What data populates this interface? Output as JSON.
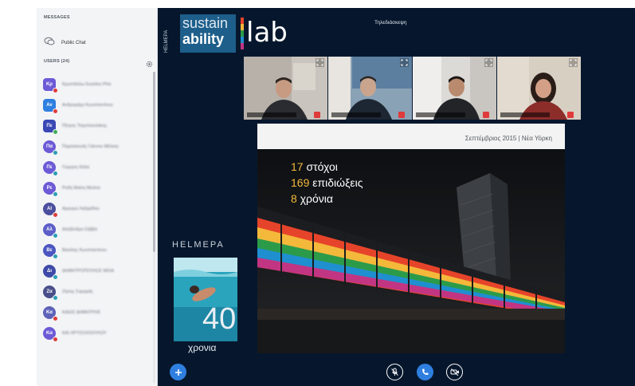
{
  "sidebar": {
    "messages_label": "MESSAGES",
    "public_chat_label": "Public Chat",
    "users_label": "USERS (24)",
    "users": [
      {
        "initials": "Κρ",
        "name": "Κρυστάλλω Ευαλίου Ρίτα",
        "color": "#6c5ad6",
        "shape": "square",
        "status": "red"
      },
      {
        "initials": "Αν",
        "name": "Ανδρομάχη Κωνσταντίνου",
        "color": "#2f7fe0",
        "shape": "square",
        "status": "red"
      },
      {
        "initials": "Πε",
        "name": "Πέτρος Τσιμπλουλάκης",
        "color": "#3a48b5",
        "shape": "square",
        "status": "green"
      },
      {
        "initials": "Πα",
        "name": "Παρασκευάς Γιάννου Μέλκας",
        "color": "#6c5ad6",
        "shape": "round",
        "status": "teal"
      },
      {
        "initials": "Πε",
        "name": "Γιώργος Κάλα",
        "color": "#6c5ad6",
        "shape": "round",
        "status": "teal"
      },
      {
        "initials": "Ρε",
        "name": "Ροδή Μαίνη Μελίνα",
        "color": "#6c5ad6",
        "shape": "round",
        "status": "teal"
      },
      {
        "initials": "ΑΙ",
        "name": "Αργυρώ Λαζαρίδου",
        "color": "#4c4f9e",
        "shape": "round",
        "status": "red"
      },
      {
        "initials": "Αλ",
        "name": "Αλεξάνδρα Σάββα",
        "color": "#5c5fc8",
        "shape": "round",
        "status": "teal"
      },
      {
        "initials": "Βε",
        "name": "Βασίλης Κωνσταντίνου",
        "color": "#4c56c0",
        "shape": "round",
        "status": "teal"
      },
      {
        "initials": "Δι",
        "name": "ΔΗΜΗΤΡΟΠΟΥΛΟΣ ΜΙΧΑ",
        "color": "#3e4aa8",
        "shape": "round",
        "status": "teal"
      },
      {
        "initials": "Ζα",
        "name": "Ζήσης Σαμαράς",
        "color": "#4a4f8a",
        "shape": "round",
        "status": "teal"
      },
      {
        "initials": "Κα",
        "name": "ΚΑΙΩΣ ΔΗΜΗΤΡΗΣ",
        "color": "#5e63b8",
        "shape": "round",
        "status": "red"
      },
      {
        "initials": "Κα",
        "name": "ΚΑΙ ΧΡΥΣΟΧΟΟΥΛΟΥ",
        "color": "#6c5ad6",
        "shape": "round",
        "status": "red"
      }
    ]
  },
  "header": {
    "org_vertical": "HELMEPA",
    "logo_sustain": "sustain",
    "logo_ability": "ability",
    "logo_lab": "lab",
    "meeting_title": "Τηλεδιάσκεψη"
  },
  "slide": {
    "caption": "Σεπτέμβριος 2015 | Νέα Υόρκη",
    "goals_num": "17",
    "goals_text": "στόχοι",
    "targets_num": "169",
    "targets_text": "επιδιώξεις",
    "years_num": "8",
    "years_text": "χρόνια"
  },
  "ad": {
    "brand": "HELMEPA",
    "number": "40",
    "word": "χρονια"
  },
  "colors": {
    "accent": "#2f7fe0",
    "stage": "#06172d",
    "mic_off": "#df3b3b"
  },
  "icons": {
    "public_chat": "chat-bubble-icon",
    "users_settings": "gear-icon",
    "add": "plus-icon",
    "mute": "microphone-off-icon",
    "audio": "phone-icon",
    "video": "camera-off-icon",
    "expand": "fullscreen-icon"
  }
}
